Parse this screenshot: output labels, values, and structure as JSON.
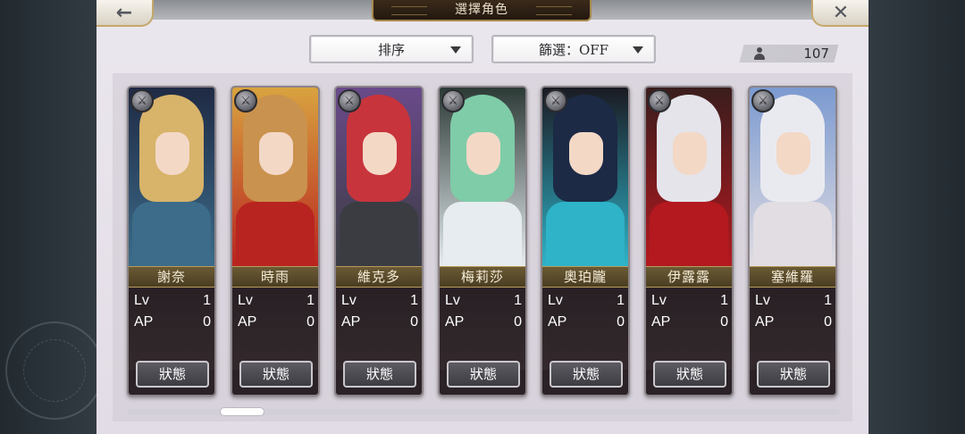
{
  "header": {
    "title": "選擇角色",
    "back_icon": "←",
    "close_icon": "✕"
  },
  "filters": {
    "sort_label": "排序",
    "filter_label": "篩選：OFF"
  },
  "roster_count": "107",
  "stat_labels": {
    "lv": "Lv",
    "ap": "AP"
  },
  "status_button_label": "狀態",
  "characters": [
    {
      "name": "謝奈",
      "lv": "1",
      "ap": "0",
      "hair": "#d8b36a",
      "outfit": "#3c6c8a",
      "accent": "#1f2a44"
    },
    {
      "name": "時雨",
      "lv": "1",
      "ap": "0",
      "hair": "#c9924e",
      "outfit": "#b8241f",
      "accent": "#d9a33f"
    },
    {
      "name": "維克多",
      "lv": "1",
      "ap": "0",
      "hair": "#c8343c",
      "outfit": "#3a3c42",
      "accent": "#6a4a8a"
    },
    {
      "name": "梅莉莎",
      "lv": "1",
      "ap": "0",
      "hair": "#7fcca8",
      "outfit": "#e6ecef",
      "accent": "#2c3a36"
    },
    {
      "name": "奧珀朧",
      "lv": "1",
      "ap": "0",
      "hair": "#1c2a46",
      "outfit": "#2fb3c8",
      "accent": "#1a1a22"
    },
    {
      "name": "伊露露",
      "lv": "1",
      "ap": "0",
      "hair": "#e4e4ea",
      "outfit": "#b3191f",
      "accent": "#3a1d1d"
    },
    {
      "name": "塞維羅",
      "lv": "1",
      "ap": "0",
      "hair": "#e9eaf0",
      "outfit": "#e1dde2",
      "accent": "#7b9ad0"
    }
  ],
  "colors": {
    "panel_bg": "#e8e3ea",
    "nameplate": "#5a4a2b",
    "gold_border": "#b89b5c"
  }
}
